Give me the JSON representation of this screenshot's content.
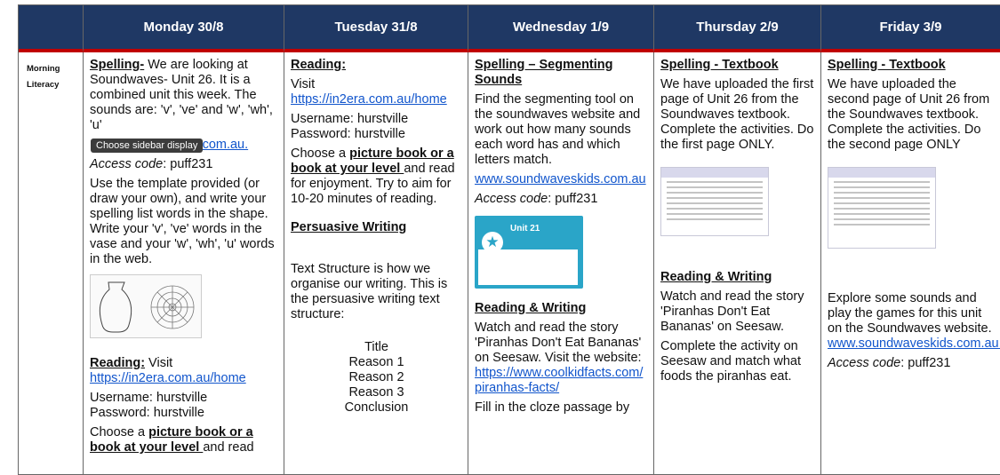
{
  "header": {
    "monday": "Monday 30/8",
    "tuesday": "Tuesday 31/8",
    "wednesday": "Wednesday 1/9",
    "thursday": "Thursday 2/9",
    "friday": "Friday 3/9"
  },
  "side": {
    "line1": "Morning",
    "line2": "Literacy"
  },
  "tooltip": "Choose sidebar display",
  "monday": {
    "spelling_head": "Spelling-",
    "spelling_text": " We are looking at Soundwaves- Unit 26. It is a combined unit this week. The sounds are: 'v', 've' and 'w', 'wh', 'u'",
    "link": "ids.com.au.",
    "access_label": "Access code",
    "access_value": ": puff231",
    "template_text": "Use the template provided (or draw your own), and write your spelling list words in the shape. Write your 'v', 've' words in the vase and your 'w', 'wh', 'u' words in the web.",
    "reading_head": "Reading:",
    "reading_text": " Visit",
    "reading_link": "https://in2era.com.au/home",
    "username": "Username: hurstville",
    "password": "Password: hurstville",
    "choose_pre": "Choose a ",
    "choose_bold": "picture book or a book at your level ",
    "choose_post": "and read"
  },
  "tuesday": {
    "reading_head": "Reading:",
    "visit": "Visit",
    "link": "https://in2era.com.au/home",
    "username": "Username: hurstville",
    "password": "Password: hurstville",
    "choose_pre": "Choose a ",
    "choose_bold": "picture book or a book at your level ",
    "choose_post": "and read for enjoyment. Try to aim for 10-20 minutes of reading.",
    "persuasive_head": "Persuasive Writing",
    "structure_text": "Text Structure is how we organise our writing. This is the persuasive writing text structure:",
    "structure_items": [
      "Title",
      "Reason 1",
      "Reason 2",
      "Reason 3",
      "Conclusion"
    ]
  },
  "wednesday": {
    "spelling_head": "Spelling – Segmenting Sounds",
    "spelling_text": "Find the segmenting tool on the soundwaves website and work out how many sounds each word has and which letters match.",
    "link": "www.soundwaveskids.com.au",
    "access_label": "Access code",
    "access_value": ": puff231",
    "card_title": "Unit 21",
    "rw_head": "Reading & Writing",
    "rw_text": "Watch and read the story 'Piranhas Don't Eat Bananas' on Seesaw. Visit the website:",
    "rw_link": "https://www.coolkidfacts.com/piranhas-facts/",
    "cloze": "Fill in the cloze passage by"
  },
  "thursday": {
    "spelling_head": "Spelling - Textbook",
    "spelling_text": "We have uploaded the first page of Unit 26 from the Soundwaves textbook. Complete the activities. Do the first page ONLY.",
    "rw_head": "Reading & Writing",
    "rw_text": "Watch and read the story 'Piranhas Don't Eat Bananas' on Seesaw.",
    "activity": "Complete the activity on Seesaw and match what foods the piranhas eat."
  },
  "friday": {
    "spelling_head": "Spelling - Textbook",
    "spelling_text": "We have uploaded the second page of Unit 26 from the Soundwaves textbook. Complete the activities. Do the second page ONLY",
    "explore": "Explore some sounds and play the games for this unit on the Soundwaves website.",
    "link": "www.soundwaveskids.com.au.",
    "access_label": "Access code",
    "access_value": ": puff231"
  }
}
